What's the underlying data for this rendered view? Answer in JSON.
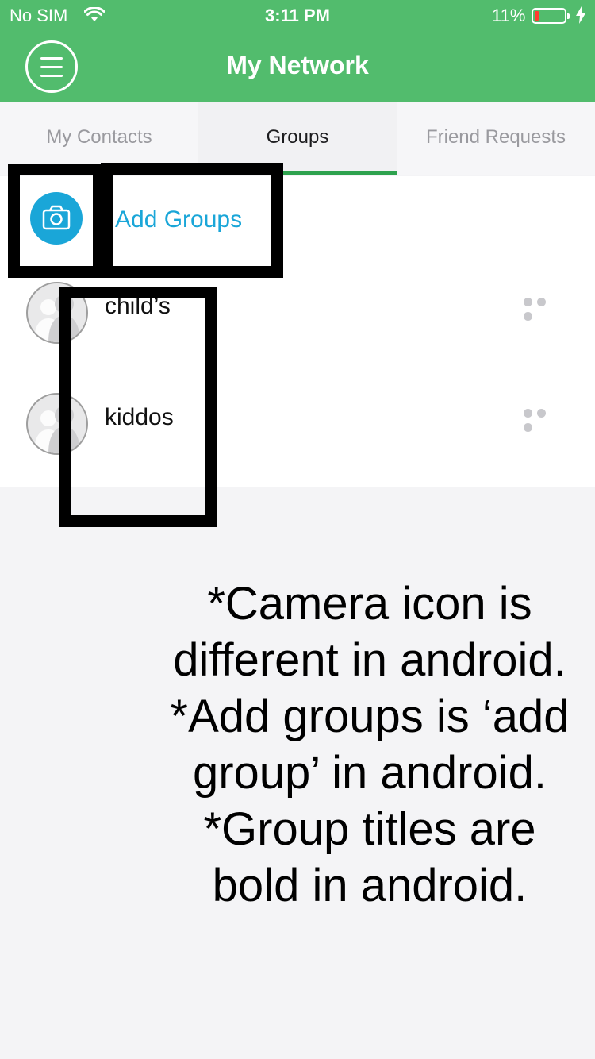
{
  "status_bar": {
    "carrier": "No SIM",
    "time": "3:11 PM",
    "battery_percent": "11%",
    "wifi_icon": "wifi-icon",
    "battery_icon": "battery-low-icon",
    "charging_icon": "charging-bolt-icon"
  },
  "header": {
    "title": "My Network",
    "menu_icon": "hamburger-menu-icon",
    "color": "#52bc6d"
  },
  "tabs": [
    {
      "label": "My Contacts",
      "active": false
    },
    {
      "label": "Groups",
      "active": true
    },
    {
      "label": "Friend Requests",
      "active": false
    }
  ],
  "add_group": {
    "label": "Add Groups",
    "icon": "camera-icon",
    "color": "#1aa6d8"
  },
  "groups": [
    {
      "name": "child’s",
      "avatar_icon": "group-avatar-icon",
      "more_icon": "more-options-icon"
    },
    {
      "name": "kiddos",
      "avatar_icon": "group-avatar-icon",
      "more_icon": "more-options-icon"
    }
  ],
  "note": [
    "*Camera icon is different in android.",
    "*Add groups is ‘add group’ in android.",
    "*Group titles are bold in android."
  ]
}
